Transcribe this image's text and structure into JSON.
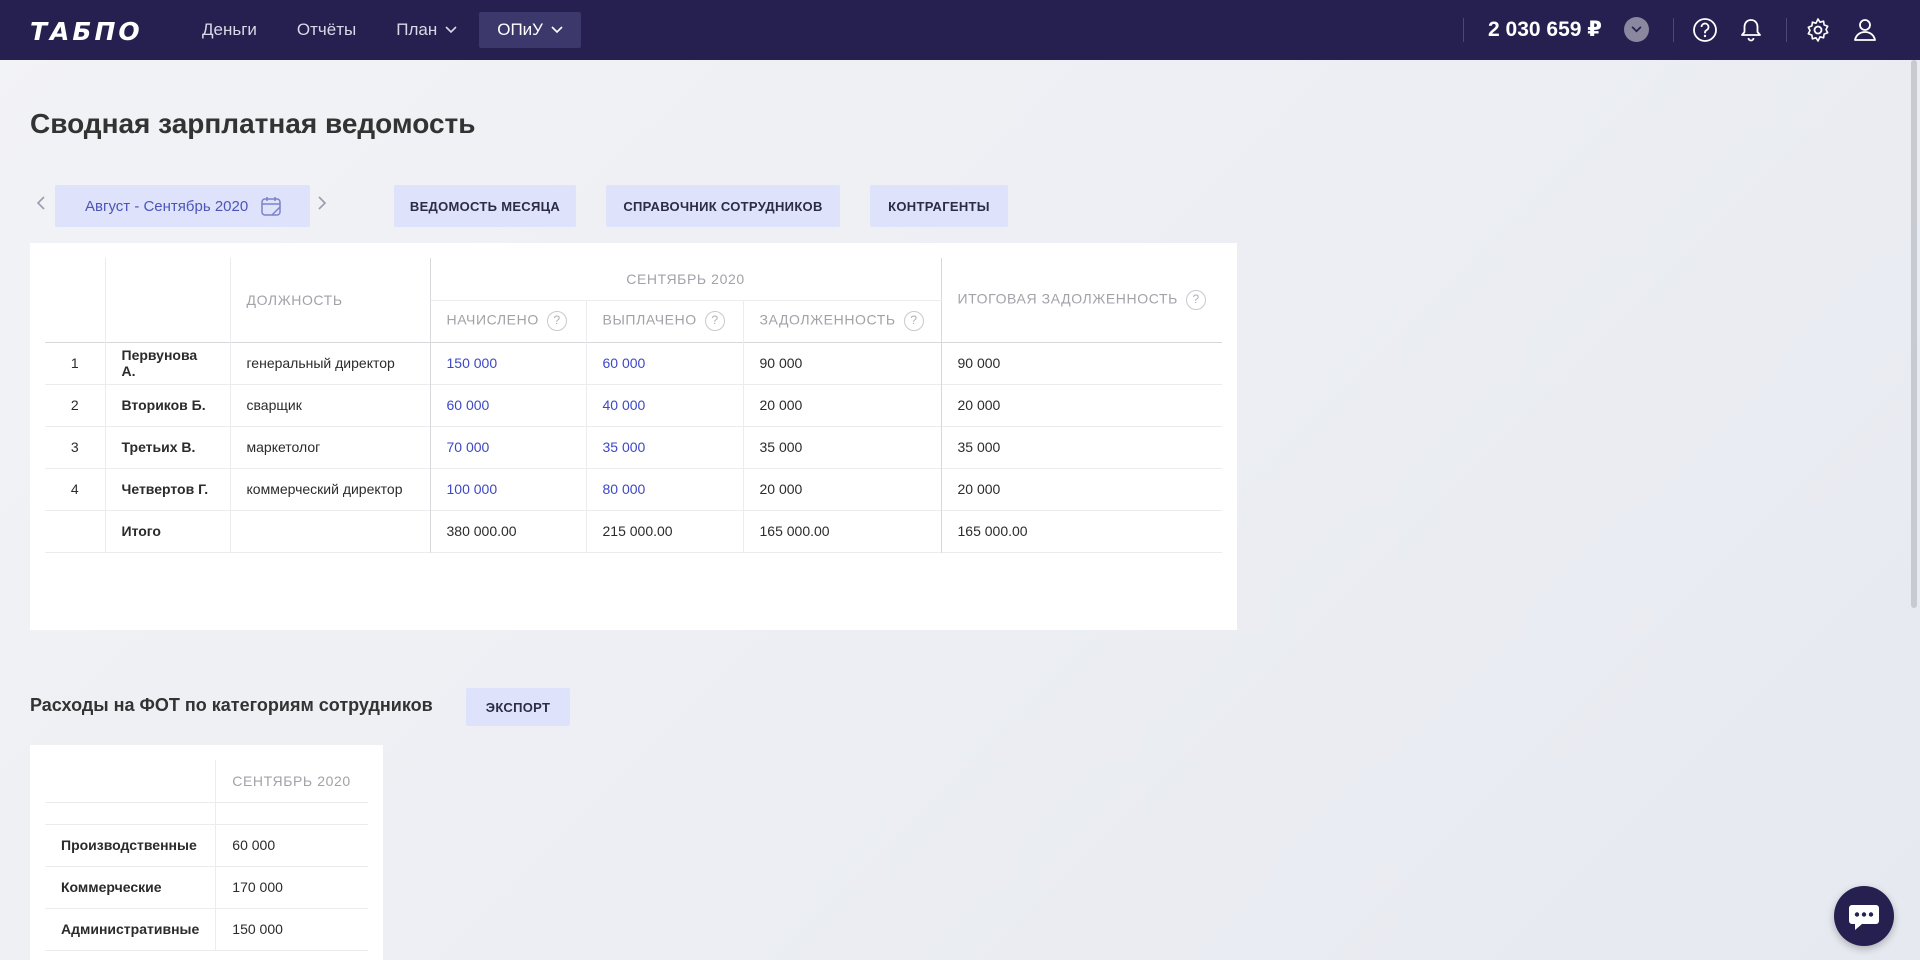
{
  "app": {
    "logo": "ТАБПО",
    "balance": "2 030 659 ₽"
  },
  "nav": [
    {
      "label": "Деньги",
      "dropdown": false,
      "active": false
    },
    {
      "label": "Отчёты",
      "dropdown": false,
      "active": false
    },
    {
      "label": "План",
      "dropdown": true,
      "active": false
    },
    {
      "label": "ОПиУ",
      "dropdown": true,
      "active": true
    }
  ],
  "icons": {
    "help": "question-circle-icon",
    "notifications": "bell-icon",
    "settings": "gear-icon",
    "profile": "user-icon",
    "chat": "chat-icon",
    "calendar": "calendar-icon"
  },
  "page": {
    "title": "Сводная зарплатная ведомость"
  },
  "toolbar": {
    "period": "Август - Сентябрь 2020",
    "month_sheet": "ВЕДОМОСТЬ МЕСЯЦА",
    "employees": "СПРАВОЧНИК СОТРУДНИКОВ",
    "counterparties": "КОНТРАГЕНТЫ"
  },
  "salary_table": {
    "headers": {
      "position": "ДОЛЖНОСТЬ",
      "month": "СЕНТЯБРЬ 2020",
      "accrued": "НАЧИСЛЕНО",
      "paid": "ВЫПЛАЧЕНО",
      "debt": "ЗАДОЛЖЕННОСТЬ",
      "total_debt": "ИТОГОВАЯ ЗАДОЛЖЕННОСТЬ"
    },
    "rows": [
      {
        "num": "1",
        "name": "Первунова А.",
        "position": "генеральный директор",
        "accrued": "150 000",
        "paid": "60 000",
        "debt": "90 000",
        "total_debt": "90 000"
      },
      {
        "num": "2",
        "name": "Вториков Б.",
        "position": "сварщик",
        "accrued": "60 000",
        "paid": "40 000",
        "debt": "20 000",
        "total_debt": "20 000"
      },
      {
        "num": "3",
        "name": "Третьих В.",
        "position": "маркетолог",
        "accrued": "70 000",
        "paid": "35 000",
        "debt": "35 000",
        "total_debt": "35 000"
      },
      {
        "num": "4",
        "name": "Четвертов Г.",
        "position": "коммерческий директор",
        "accrued": "100 000",
        "paid": "80 000",
        "debt": "20 000",
        "total_debt": "20 000"
      }
    ],
    "total": {
      "label": "Итого",
      "accrued": "380 000.00",
      "paid": "215 000.00",
      "debt": "165 000.00",
      "total_debt": "165 000.00"
    }
  },
  "fot": {
    "title": "Расходы на ФОТ по категориям сотрудников",
    "export": "ЭКСПОРТ",
    "header": "СЕНТЯБРЬ 2020",
    "rows": [
      {
        "category": "Производственные",
        "value": "60 000"
      },
      {
        "category": "Коммерческие",
        "value": "170 000"
      },
      {
        "category": "Административные",
        "value": "150 000"
      }
    ]
  }
}
